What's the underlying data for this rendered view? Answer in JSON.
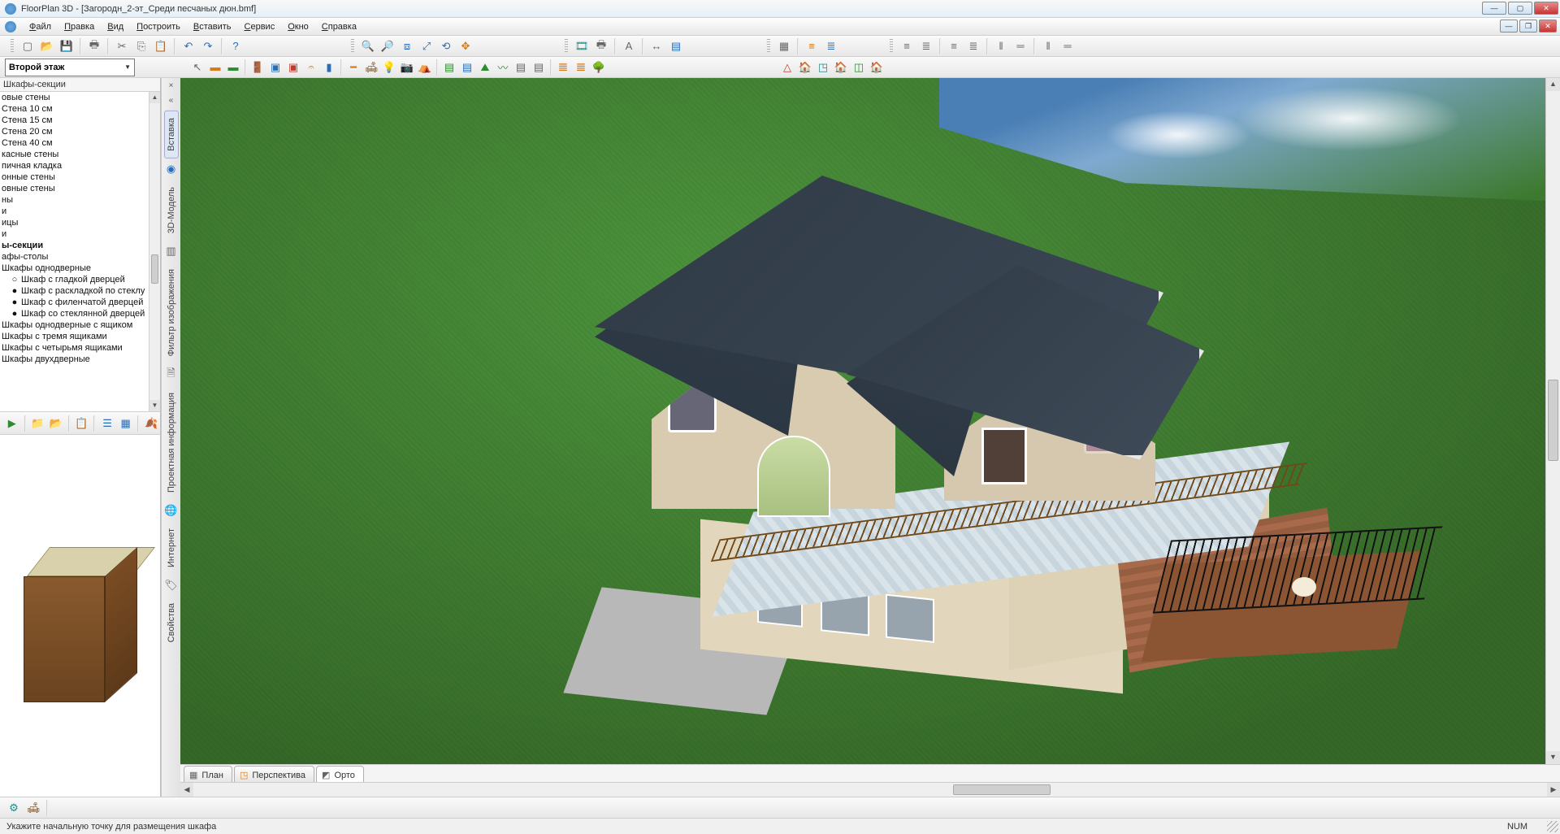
{
  "app": {
    "title": "FloorPlan 3D - [Загородн_2-эт_Среди песчаных дюн.bmf]"
  },
  "menu": {
    "file": "Файл",
    "edit": "Правка",
    "view": "Вид",
    "build": "Построить",
    "insert": "Вставить",
    "service": "Сервис",
    "window": "Окно",
    "help": "Справка"
  },
  "floor_selector": {
    "value": "Второй этаж"
  },
  "sidebar": {
    "title": "Шкафы-секции",
    "items": [
      {
        "label": "овые стены"
      },
      {
        "label": "Стена 10 см"
      },
      {
        "label": "Стена 15 см"
      },
      {
        "label": "Стена 20 см"
      },
      {
        "label": "Стена 40 см"
      },
      {
        "label": "касные стены"
      },
      {
        "label": "пичная кладка"
      },
      {
        "label": "онные стены"
      },
      {
        "label": "овные стены"
      },
      {
        "label": "ны"
      },
      {
        "label": "и"
      },
      {
        "label": "ицы"
      },
      {
        "label": "и"
      },
      {
        "label": "ы-секции",
        "bold": true
      },
      {
        "label": "афы-столы"
      },
      {
        "label": "Шкафы однодверные"
      },
      {
        "label": "Шкаф с гладкой дверцей",
        "sub": true,
        "bullet": "○"
      },
      {
        "label": "Шкаф с раскладкой по стеклу",
        "sub": true,
        "bullet": "●"
      },
      {
        "label": "Шкаф с филенчатой дверцей",
        "sub": true,
        "bullet": "●"
      },
      {
        "label": "Шкаф со стеклянной дверцей",
        "sub": true,
        "bullet": "●"
      },
      {
        "label": "Шкафы однодверные с ящиком"
      },
      {
        "label": "Шкафы с тремя ящиками"
      },
      {
        "label": "Шкафы с четырьмя ящиками"
      },
      {
        "label": "Шкафы двухдверные"
      }
    ]
  },
  "vertical_tabs": {
    "insert": "Вставка",
    "model3d": "3D-Модель",
    "imgfilter": "Фильтр изображения",
    "project": "Проектная информация",
    "internet": "Интернет",
    "props": "Свойства"
  },
  "view_tabs": {
    "plan": "План",
    "perspective": "Перспектива",
    "ortho": "Орто"
  },
  "status": {
    "hint": "Укажите начальную точку для размещения шкафа",
    "num": "NUM"
  },
  "icons": {
    "new": "▢",
    "open": "📂",
    "save": "💾",
    "print": "🖶",
    "cut": "✂",
    "copy": "⎘",
    "paste": "📋",
    "undo": "↶",
    "redo": "↷",
    "help": "?",
    "zoom_in": "🔍",
    "zoom_out": "🔎",
    "zoom_win": "⧈",
    "zoom_ext": "⤢",
    "zoom_prev": "⟲",
    "pan": "✥",
    "refresh": "⟳",
    "render": "🎞",
    "print2": "🖶",
    "text": "A",
    "dim": "↔",
    "layer": "▤",
    "grid": "▦",
    "align_l": "≡",
    "align_c": "≣",
    "dist_h": "‖",
    "dist_v": "═",
    "pointer": "↖",
    "wall": "▬",
    "door": "🚪",
    "window": "▣",
    "roof": "⛺",
    "stairs": "𝄐",
    "column": "▮",
    "beam": "━",
    "furniture": "🛋",
    "light": "💡",
    "camera": "📷",
    "tree": "🌳",
    "terrain": "⛰",
    "path": "〰",
    "fence": "𝌆",
    "pool": "◍",
    "plan2d": "▦",
    "view3d": "◳",
    "walk": "🚶",
    "fly": "✈",
    "ortho_i": "◫",
    "folder": "📁",
    "folder_open": "📂",
    "props": "📋",
    "list": "☰",
    "grid2": "▦",
    "leaf": "🍂",
    "gear": "⚙",
    "globe": "🌐",
    "tag": "🏷",
    "house": "🏠",
    "roof_i": "△"
  }
}
